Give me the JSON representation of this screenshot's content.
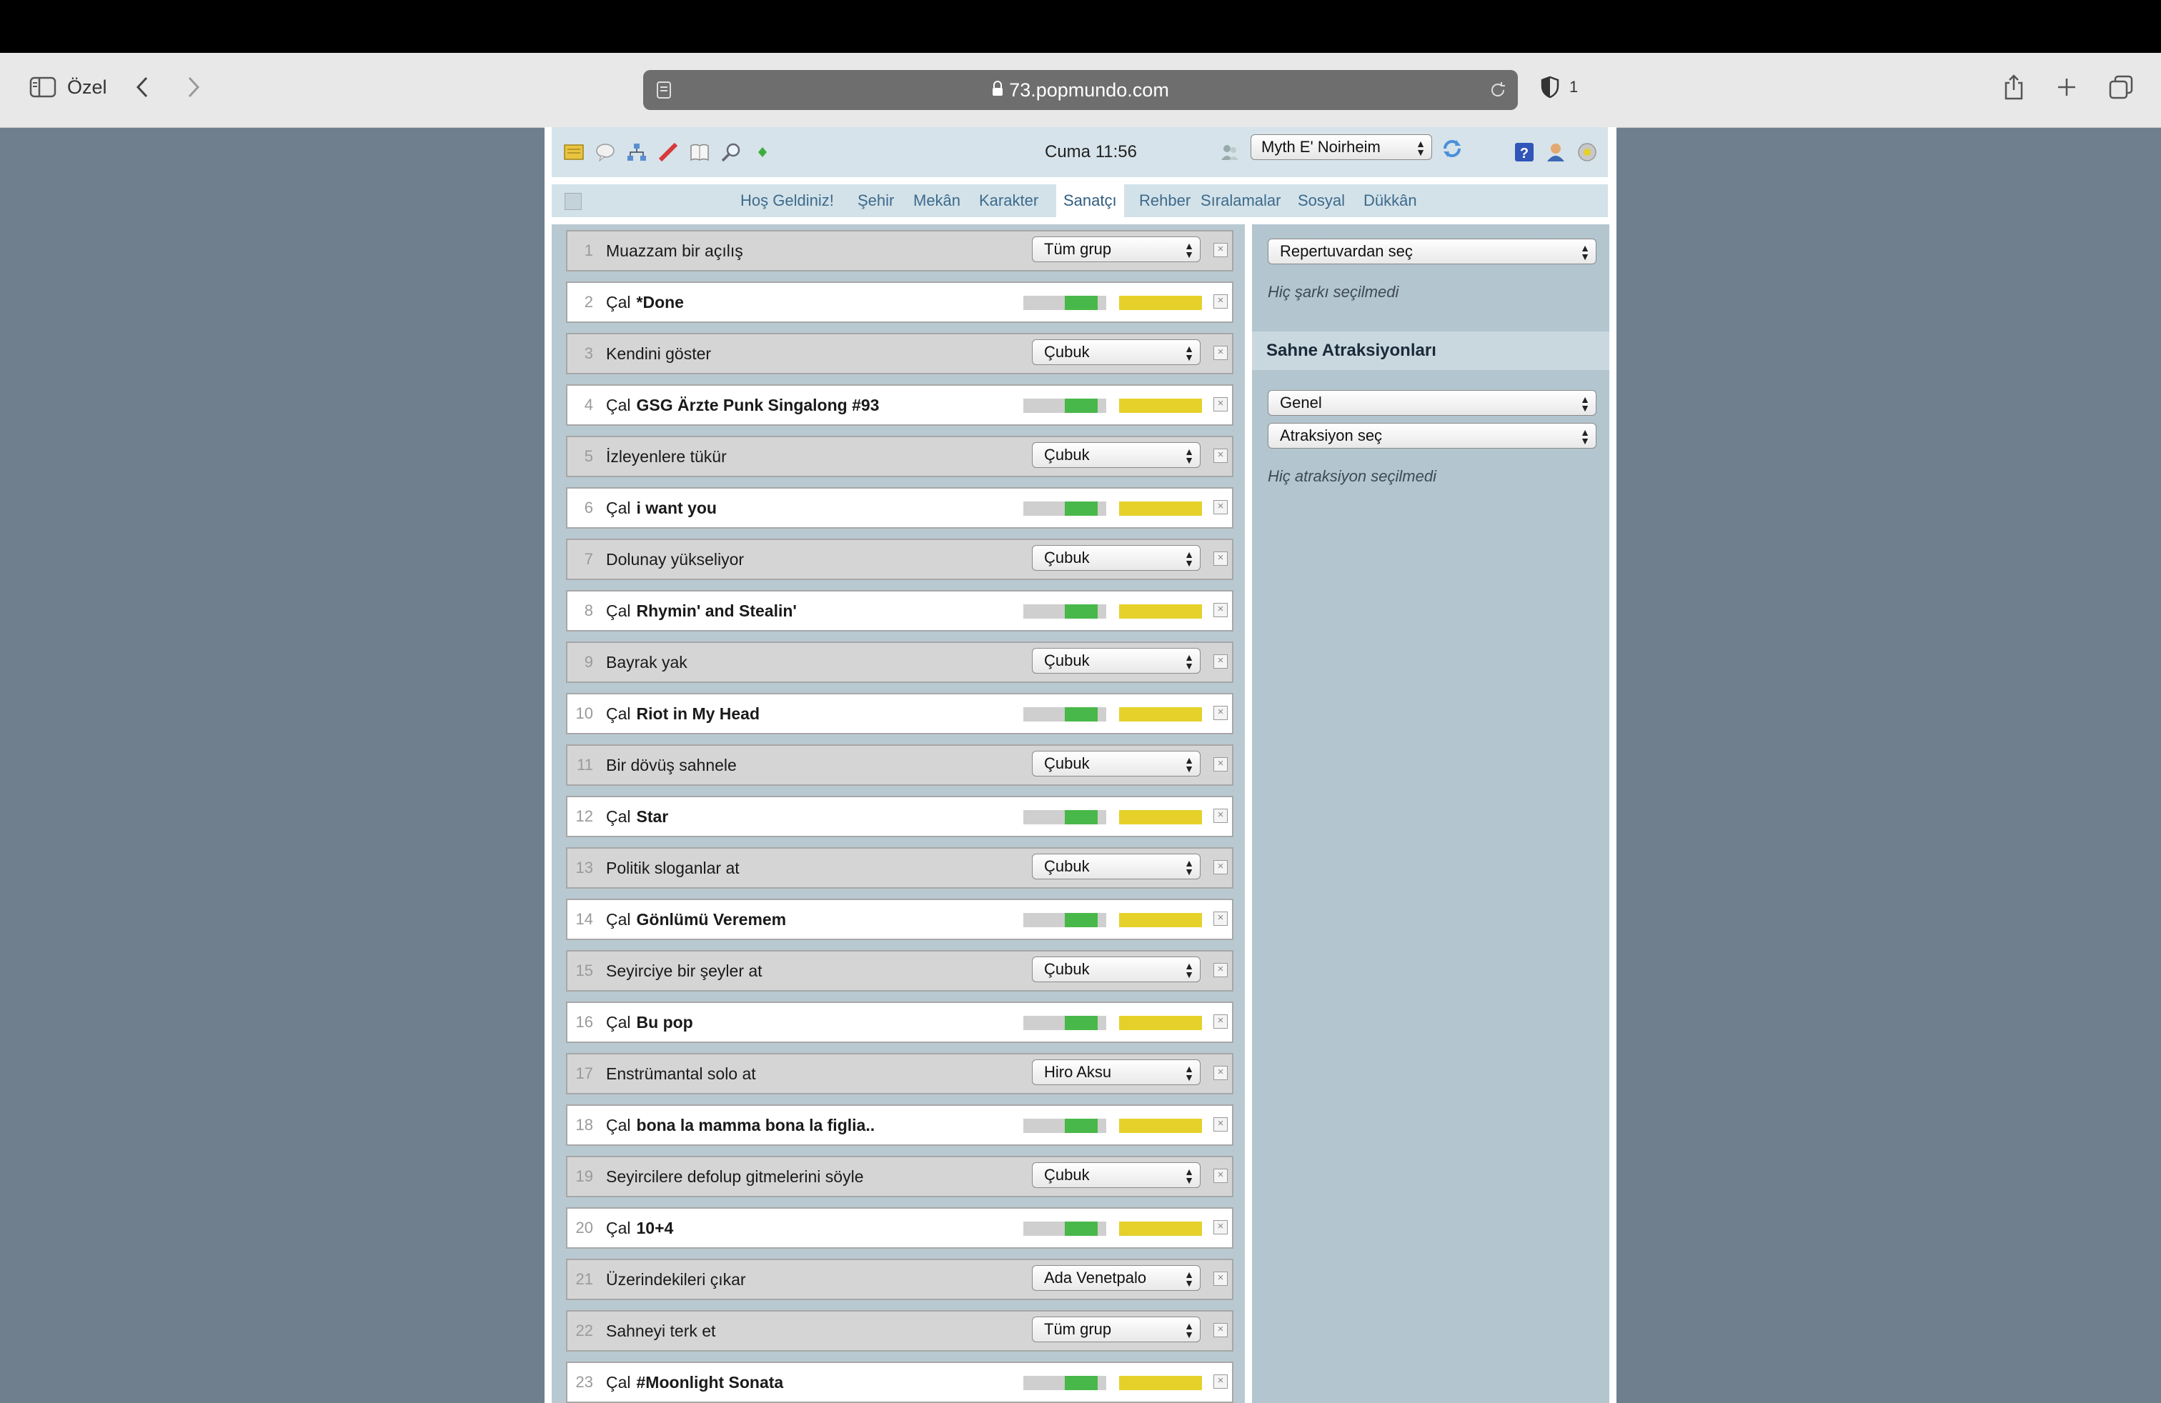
{
  "browser": {
    "profile_label": "Özel",
    "url": "73.popmundo.com",
    "shield_count": "1"
  },
  "game": {
    "clock": "Cuma 11:56",
    "character_selected": "Myth E' Noirheim",
    "nav": [
      "Hoş Geldiniz!",
      "Şehir",
      "Mekân",
      "Karakter",
      "Sanatçı",
      "Rehber",
      "Sıralamalar",
      "Sosyal",
      "Dükkân"
    ],
    "nav_active": "Sanatçı"
  },
  "setlist": [
    {
      "n": "1",
      "type": "act",
      "text": "Muazzam bir açılış",
      "select": "Tüm grup"
    },
    {
      "n": "2",
      "type": "play",
      "prefix": "Çal",
      "song": "*Done"
    },
    {
      "n": "3",
      "type": "act",
      "text": "Kendini göster",
      "select": "Çubuk"
    },
    {
      "n": "4",
      "type": "play",
      "prefix": "Çal",
      "song": "GSG Ärzte Punk Singalong #93"
    },
    {
      "n": "5",
      "type": "act",
      "text": "İzleyenlere tükür",
      "select": "Çubuk"
    },
    {
      "n": "6",
      "type": "play",
      "prefix": "Çal",
      "song": "i want you"
    },
    {
      "n": "7",
      "type": "act",
      "text": "Dolunay yükseliyor",
      "select": "Çubuk"
    },
    {
      "n": "8",
      "type": "play",
      "prefix": "Çal",
      "song": "Rhymin' and Stealin'"
    },
    {
      "n": "9",
      "type": "act",
      "text": "Bayrak yak",
      "select": "Çubuk"
    },
    {
      "n": "10",
      "type": "play",
      "prefix": "Çal",
      "song": "Riot in My Head"
    },
    {
      "n": "11",
      "type": "act",
      "text": "Bir dövüş sahnele",
      "select": "Çubuk"
    },
    {
      "n": "12",
      "type": "play",
      "prefix": "Çal",
      "song": "Star"
    },
    {
      "n": "13",
      "type": "act",
      "text": "Politik sloganlar at",
      "select": "Çubuk"
    },
    {
      "n": "14",
      "type": "play",
      "prefix": "Çal",
      "song": "Gönlümü Veremem"
    },
    {
      "n": "15",
      "type": "act",
      "text": "Seyirciye bir şeyler at",
      "select": "Çubuk"
    },
    {
      "n": "16",
      "type": "play",
      "prefix": "Çal",
      "song": "Bu pop"
    },
    {
      "n": "17",
      "type": "act",
      "text": "Enstrümantal solo at",
      "select": "Hiro Aksu"
    },
    {
      "n": "18",
      "type": "play",
      "prefix": "Çal",
      "song": "bona la mamma bona la figlia.."
    },
    {
      "n": "19",
      "type": "act",
      "text": "Seyircilere defolup gitmelerini söyle",
      "select": "Çubuk"
    },
    {
      "n": "20",
      "type": "play",
      "prefix": "Çal",
      "song": "10+4"
    },
    {
      "n": "21",
      "type": "act",
      "text": "Üzerindekileri çıkar",
      "select": "Ada Venetpalo"
    },
    {
      "n": "22",
      "type": "act",
      "text": "Sahneyi terk et",
      "select": "Tüm grup"
    },
    {
      "n": "23",
      "type": "play",
      "prefix": "Çal",
      "song": "#Moonlight Sonata"
    }
  ],
  "song_meter": {
    "skill_level": 0.5,
    "quality_level": 1.0
  },
  "sidebar": {
    "repertoire_select": "Repertuvardan seç",
    "no_song_text": "Hiç şarkı seçilmedi",
    "attractions_title": "Sahne Atraksiyonları",
    "category_select": "Genel",
    "attraction_select": "Atraksiyon seç",
    "no_attraction_text": "Hiç atraksiyon seçilmedi"
  },
  "colors": {
    "page_bg": "#6f7f8d",
    "meter_green": "#49b84a",
    "meter_yellow": "#e6d12a",
    "link": "#3d6a8c"
  }
}
